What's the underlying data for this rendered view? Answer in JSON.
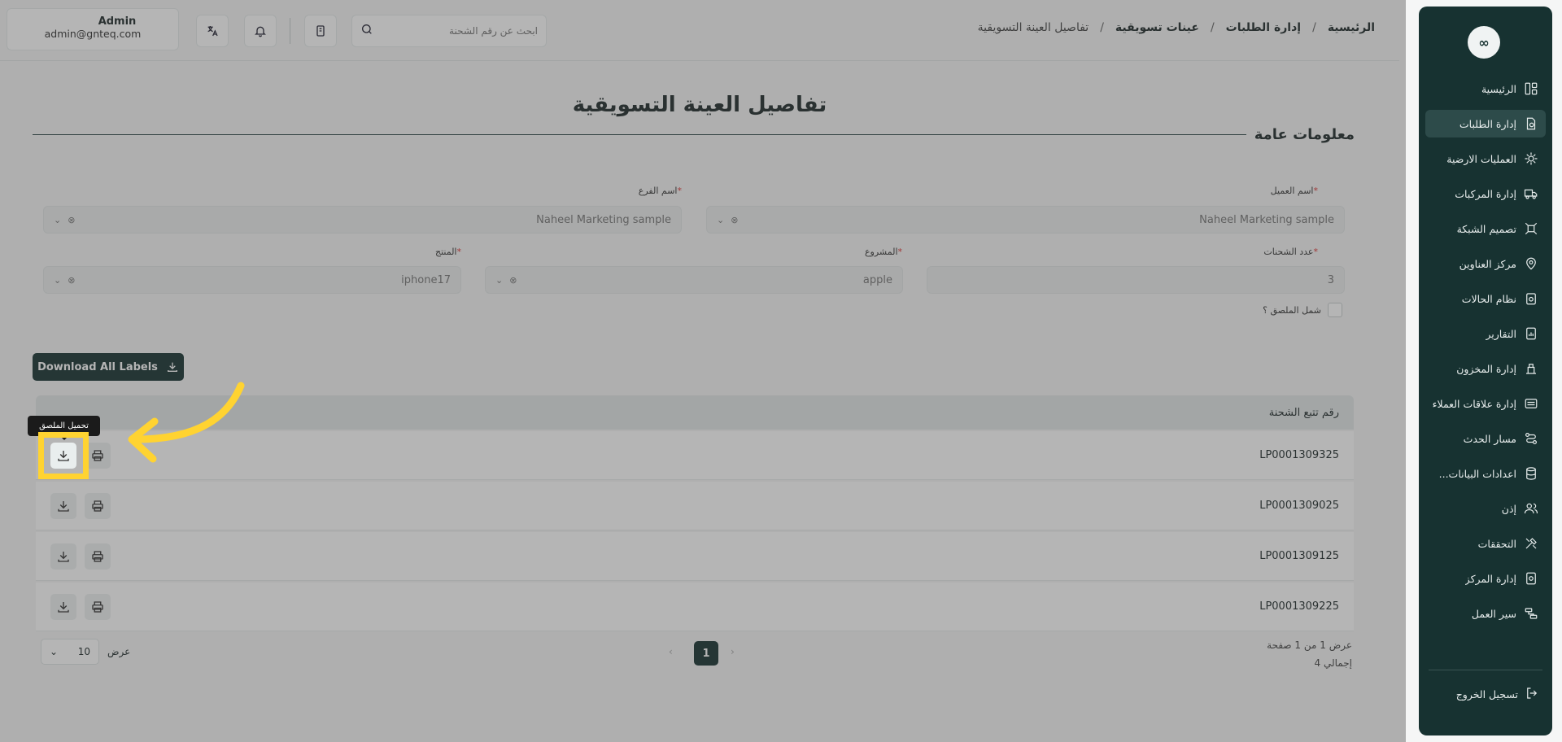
{
  "sidebar": {
    "logo_text": "∞",
    "items": [
      {
        "label": "الرئيسية",
        "icon": "dashboard-icon",
        "active": false
      },
      {
        "label": "إدارة الطلبات",
        "icon": "orders-icon",
        "active": true
      },
      {
        "label": "العمليات الارضية",
        "icon": "ground-ops-icon",
        "active": false
      },
      {
        "label": "إدارة المركبات",
        "icon": "truck-icon",
        "active": false
      },
      {
        "label": "تصميم الشبكة",
        "icon": "network-icon",
        "active": false
      },
      {
        "label": "مركز العناوين",
        "icon": "location-icon",
        "active": false
      },
      {
        "label": "نظام الحالات",
        "icon": "status-icon",
        "active": false
      },
      {
        "label": "التقارير",
        "icon": "report-icon",
        "active": false
      },
      {
        "label": "إدارة المخزون",
        "icon": "inventory-icon",
        "active": false
      },
      {
        "label": "إدارة علاقات العملاء",
        "icon": "crm-icon",
        "active": false
      },
      {
        "label": "مسار الحدث",
        "icon": "route-icon",
        "active": false
      },
      {
        "label": "اعدادات البيانات...",
        "icon": "database-icon",
        "active": false
      },
      {
        "label": "إذن",
        "icon": "users-icon",
        "active": false
      },
      {
        "label": "التحققات",
        "icon": "tools-icon",
        "active": false
      },
      {
        "label": "إدارة المركز",
        "icon": "hub-icon",
        "active": false
      },
      {
        "label": "سير العمل",
        "icon": "workflow-icon",
        "active": false
      }
    ],
    "logout_label": "تسجيل الخروج"
  },
  "header": {
    "breadcrumb": [
      "الرئيسية",
      "إدارة الطلبات",
      "عينات تسويقية",
      "تفاصيل العينة التسويقية"
    ],
    "breadcrumb_sep": "/",
    "search_placeholder": "ابحث عن رقم الشحنة",
    "user_name": "Admin",
    "user_email": "admin@gnteq.com"
  },
  "page": {
    "title": "تفاصيل العينة التسويقية",
    "section_title": "معلومات عامة",
    "required_mark": "*",
    "fields": {
      "client_label": "اسم العميل",
      "client_value": "Naheel Marketing sample",
      "branch_label": "اسم الفرع",
      "branch_value": "Naheel Marketing sample",
      "shipments_label": "عدد الشحنات",
      "shipments_value": "3",
      "project_label": "المشروع",
      "project_value": "apple",
      "product_label": "المنتج",
      "product_value": "iphone17",
      "include_label": "شمل الملصق ؟"
    },
    "download_all_label": "Download All Labels",
    "table": {
      "header": "رقم تتبع الشحنة",
      "rows": [
        "LP0001309325",
        "LP0001309025",
        "LP0001309125",
        "LP0001309225"
      ]
    },
    "pagination": {
      "current_page": "1",
      "info": "عرض 1 من 1 صفحة",
      "total": "إجمالي 4",
      "show_label": "عرض",
      "page_size": "10"
    },
    "tooltip": "تحميل الملصق"
  },
  "colors": {
    "sidebar": "#173231",
    "highlight": "#ffd331",
    "primary": "#173231"
  }
}
